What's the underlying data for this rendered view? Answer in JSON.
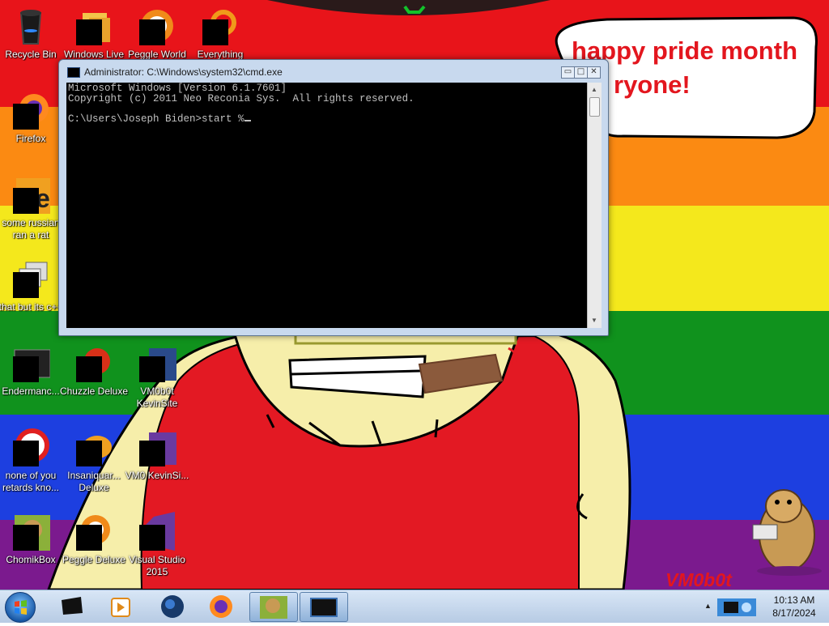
{
  "desktop": {
    "bubble_lines": [
      "happy pride month",
      "ryone!"
    ],
    "watermark": "VM0b0t",
    "icons": [
      {
        "label": "Recycle Bin"
      },
      {
        "label": "Windows Live"
      },
      {
        "label": "Peggle World"
      },
      {
        "label": "Everything"
      },
      {
        "label": "Firefox"
      },
      {
        "label": "some russian ran a rat"
      },
      {
        "label": "that but its c++"
      },
      {
        "label": "Endermanc..."
      },
      {
        "label": "Chuzzle Deluxe"
      },
      {
        "label": "VM0b0t KevinSite"
      },
      {
        "label": "none of you retards kno..."
      },
      {
        "label": "Insaniquar... Deluxe"
      },
      {
        "label": "VM0 KevinSi..."
      },
      {
        "label": "ChomikBox"
      },
      {
        "label": "Peggle Deluxe"
      },
      {
        "label": "Visual Studio 2015"
      }
    ]
  },
  "cmd": {
    "title": "Administrator: C:\\Windows\\system32\\cmd.exe",
    "minimize_glyph": "▭",
    "maximize_glyph": "□",
    "close_glyph": "✕",
    "line1": "Microsoft Windows [Version 6.1.7601]",
    "line2": "Copyright (c) 2011 Neo Reconia Sys.  All rights reserved.",
    "line3": "",
    "line4": "C:\\Users\\Joseph Biden>start %",
    "scroll_up": "▲",
    "scroll_down": "▼"
  },
  "taskbar": {
    "tray_arrow": "▲",
    "time": "10:13 AM",
    "date": "8/17/2024",
    "pinned": [
      "task-manager",
      "media-player",
      "network-globe",
      "firefox"
    ],
    "running": [
      "chomikbox",
      "cmd"
    ]
  },
  "colors": {
    "pride_red": "#e8141a",
    "pride_orange": "#fb8a12",
    "pride_yellow": "#f4e81c",
    "pride_green": "#10921d",
    "pride_blue": "#1d3fe0",
    "pride_purple": "#7b1a8e"
  }
}
